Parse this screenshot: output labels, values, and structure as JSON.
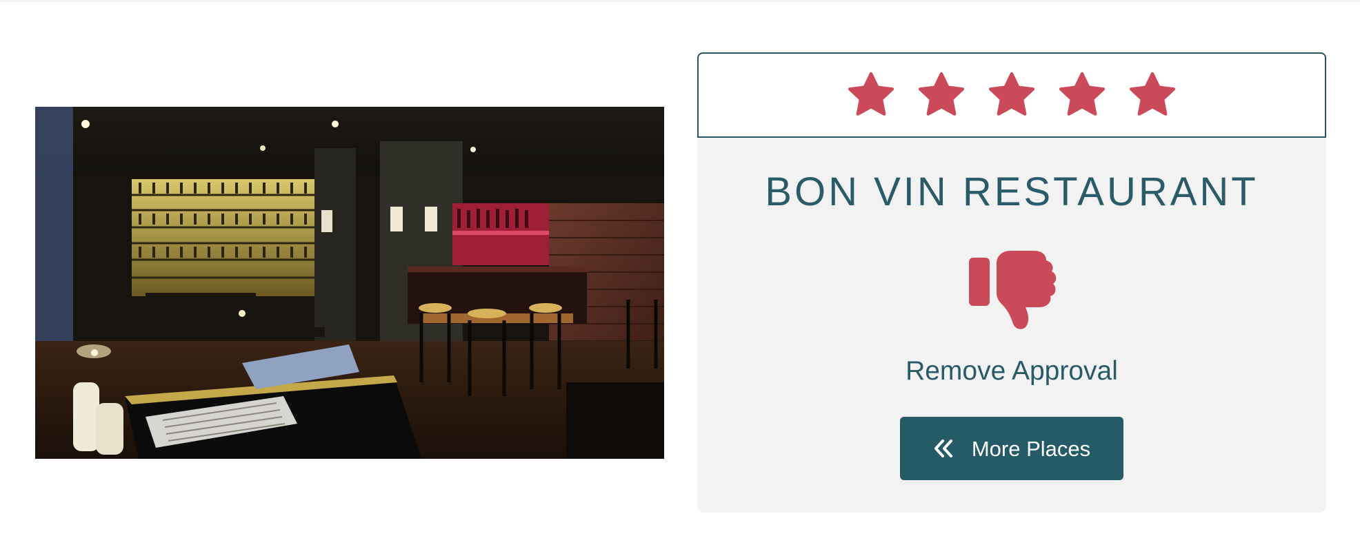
{
  "place": {
    "name": "BON VIN RESTAURANT",
    "rating": 5,
    "rating_max": 5,
    "star_color": "#cb4a5a",
    "image_icon": "restaurant-photo"
  },
  "actions": {
    "approval_icon": "thumbs-down-icon",
    "approval_label": "Remove Approval",
    "more_icon": "double-chevron-left-icon",
    "more_label": "More Places"
  },
  "colors": {
    "primary": "#255b66",
    "accent": "#cb4a5a",
    "card_bg": "#f2f2f2"
  }
}
